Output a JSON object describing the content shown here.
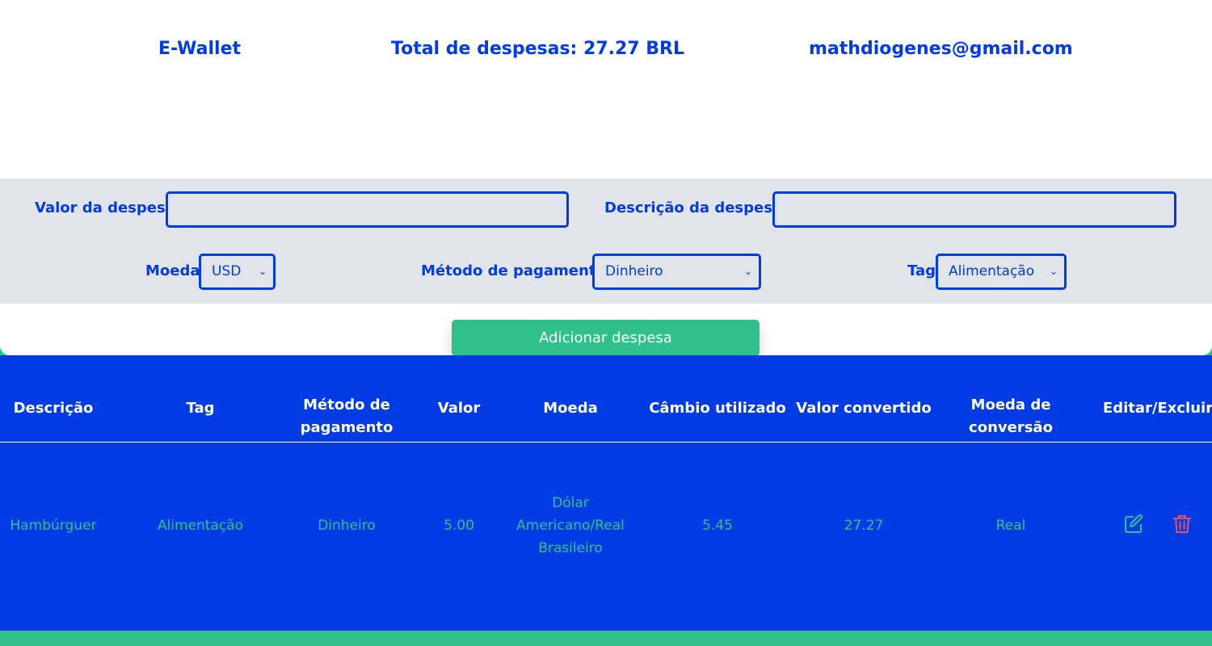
{
  "header": {
    "app_name": "E-Wallet",
    "total_label": "Total de despesas: 27.27 BRL",
    "email": "mathdiogenes@gmail.com"
  },
  "form": {
    "value_label": "Valor da despesa",
    "value_input": "",
    "description_label": "Descrição da despesa",
    "description_input": "",
    "currency_label": "Moeda",
    "currency_selected": "USD",
    "method_label": "Método de pagamento",
    "method_selected": "Dinheiro",
    "tag_label": "Tag",
    "tag_selected": "Alimentação",
    "add_button": "Adicionar despesa"
  },
  "table": {
    "headers": [
      "Descrição",
      "Tag",
      "Método de pagamento",
      "Valor",
      "Moeda",
      "Câmbio utilizado",
      "Valor convertido",
      "Moeda de conversão",
      "Editar/Excluir"
    ],
    "rows": [
      {
        "descricao": "Hambúrguer",
        "tag": "Alimentação",
        "metodo": "Dinheiro",
        "valor": "5.00",
        "moeda": "Dólar Americano/Real Brasileiro",
        "cambio": "5.45",
        "valor_convertido": "27.27",
        "moeda_conversao": "Real",
        "edit_icon": "edit-icon",
        "delete_icon": "trash-icon"
      }
    ]
  },
  "colors": {
    "primary_blue": "#003be5",
    "green": "#2fc18c",
    "form_gray": "#e1e5eb",
    "delete_red": "#f04f5f"
  }
}
